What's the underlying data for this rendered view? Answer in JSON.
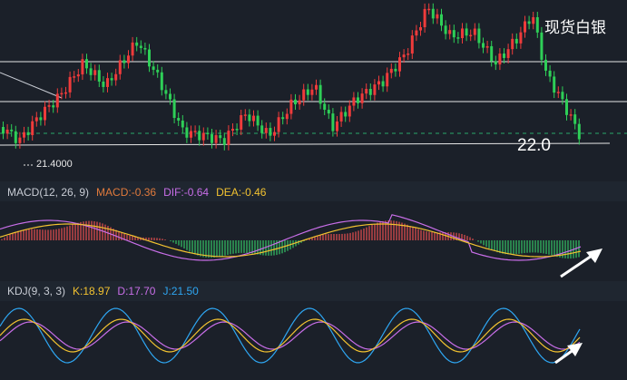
{
  "chart_data": [
    {
      "type": "candlestick",
      "title": "现货白银",
      "annotations": {
        "low_label": "21.4000",
        "support_level_label": "22.0"
      },
      "colors": {
        "up": "#ef3b3b",
        "down": "#2ecf57",
        "ref_line": "#e6e6e6",
        "dashed_line": "#29a86a"
      }
    },
    {
      "type": "line",
      "indicator": "MACD",
      "params_label": "MACD(12, 26, 9)",
      "values": {
        "MACD": -0.36,
        "DIF": -0.64,
        "DEA": -0.46
      },
      "value_labels": {
        "MACD": "MACD:-0.36",
        "DIF": "DIF:-0.64",
        "DEA": "DEA:-0.46"
      },
      "colors": {
        "MACD": "#e07a3c",
        "DIF": "#c86ee8",
        "DEA": "#f2c230"
      }
    },
    {
      "type": "line",
      "indicator": "KDJ",
      "params_label": "KDJ(9, 3, 3)",
      "values": {
        "K": 18.97,
        "D": 17.7,
        "J": 21.5
      },
      "value_labels": {
        "K": "K:18.97",
        "D": "D:17.70",
        "J": "J:21.50"
      },
      "colors": {
        "K": "#f2c230",
        "D": "#c86ee8",
        "J": "#2ea6f2"
      }
    }
  ]
}
